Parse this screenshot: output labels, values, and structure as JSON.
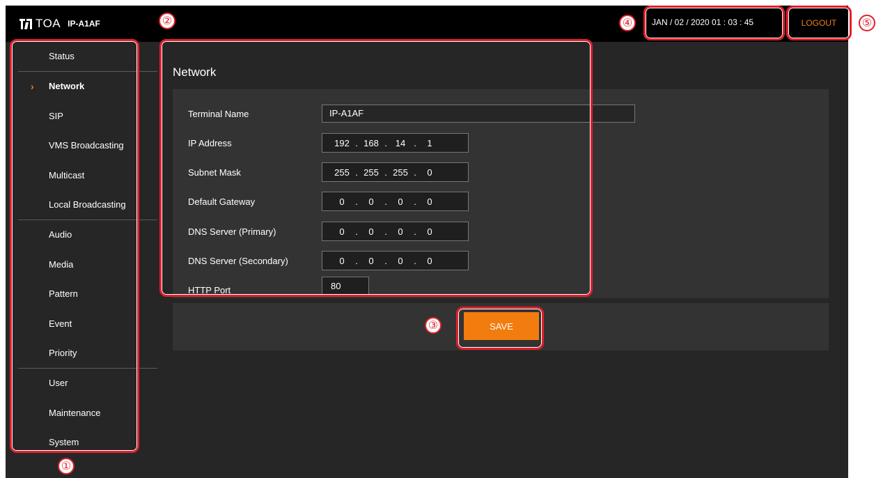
{
  "header": {
    "brand": "TOA",
    "model": "IP-A1AF",
    "datetime": "JAN / 02 / 2020   01 : 03 : 45",
    "logout_label": "LOGOUT"
  },
  "sidebar": {
    "active_item": "Network",
    "groups": [
      [
        "Status"
      ],
      [
        "Network",
        "SIP",
        "VMS Broadcasting",
        "Multicast",
        "Local Broadcasting"
      ],
      [
        "Audio",
        "Media",
        "Pattern",
        "Event",
        "Priority"
      ],
      [
        "User",
        "Maintenance",
        "System"
      ]
    ]
  },
  "main": {
    "title": "Network",
    "fields": [
      {
        "label": "Terminal Name",
        "type": "text",
        "value": "IP-A1AF"
      },
      {
        "label": "IP Address",
        "type": "ip",
        "octets": [
          "192",
          "168",
          "14",
          "1"
        ]
      },
      {
        "label": "Subnet Mask",
        "type": "ip",
        "octets": [
          "255",
          "255",
          "255",
          "0"
        ]
      },
      {
        "label": "Default Gateway",
        "type": "ip",
        "octets": [
          "0",
          "0",
          "0",
          "0"
        ]
      },
      {
        "label": "DNS Server (Primary)",
        "type": "ip",
        "octets": [
          "0",
          "0",
          "0",
          "0"
        ]
      },
      {
        "label": "DNS Server (Secondary)",
        "type": "ip",
        "octets": [
          "0",
          "0",
          "0",
          "0"
        ]
      },
      {
        "label": "HTTP Port",
        "type": "port",
        "value": "80"
      }
    ],
    "save_label": "SAVE"
  },
  "callouts": [
    "①",
    "②",
    "③",
    "④",
    "⑤"
  ],
  "colors": {
    "accent": "#f27c0d",
    "callout": "#e0202a",
    "background": "#262626",
    "panel": "#333333",
    "topbar": "#000000"
  }
}
